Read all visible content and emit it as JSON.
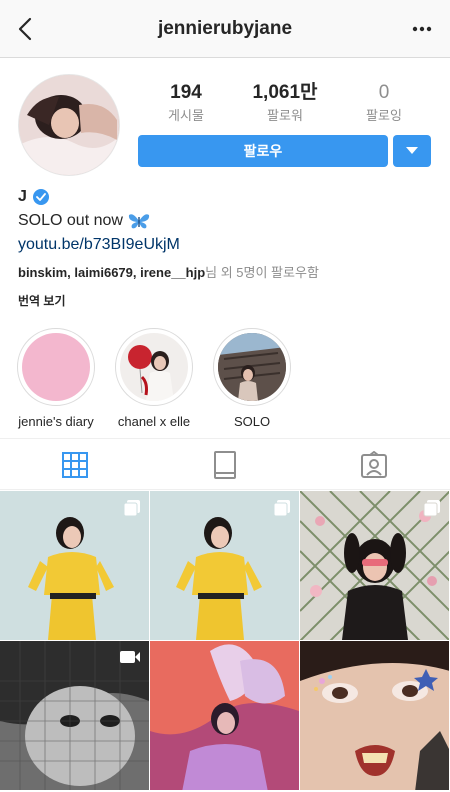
{
  "header": {
    "username": "jennierubyjane",
    "back_icon": "chevron-left-icon",
    "more_icon": "more-horizontal-icon"
  },
  "stats": [
    {
      "value": "194",
      "label": "게시물"
    },
    {
      "value": "1,061만",
      "label": "팔로워"
    },
    {
      "value": "0",
      "label": "팔로잉"
    }
  ],
  "actions": {
    "follow_label": "팔로우",
    "dropdown_icon": "caret-down-icon"
  },
  "profile": {
    "name": "J",
    "verified_icon": "verified-badge-icon",
    "bio": "SOLO out now",
    "bio_emoji": "butterfly-icon",
    "link": "youtu.be/b73BI9eUkjM",
    "followed_by_names": "binskim, laimi6679, irene__hjp",
    "followed_by_suffix": "님 외 5명이 팔로우함",
    "translate_label": "번역 보기"
  },
  "highlights": [
    {
      "label": "jennie's diary"
    },
    {
      "label": "chanel x elle"
    },
    {
      "label": "SOLO"
    }
  ],
  "tabs": [
    "grid-icon",
    "igtv-icon",
    "tagged-icon"
  ],
  "posts": [
    {
      "type": "multi",
      "badge_icon": "carousel-icon"
    },
    {
      "type": "multi",
      "badge_icon": "carousel-icon"
    },
    {
      "type": "multi",
      "badge_icon": "carousel-icon"
    },
    {
      "type": "video",
      "badge_icon": "video-icon"
    },
    {
      "type": "photo"
    },
    {
      "type": "photo"
    }
  ],
  "colors": {
    "accent": "#3897f0",
    "link": "#003569",
    "muted": "#8e8e8e",
    "text": "#262626"
  }
}
